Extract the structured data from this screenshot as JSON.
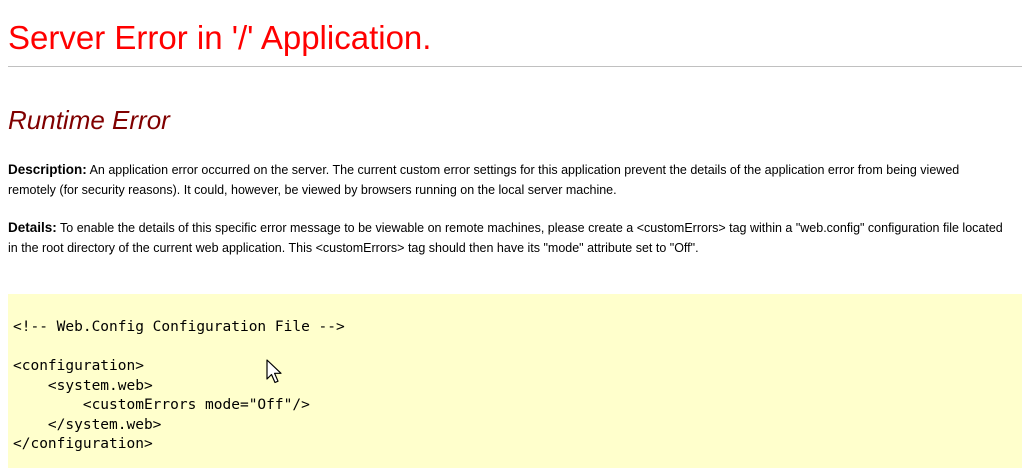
{
  "header": {
    "title": "Server Error in '/' Application."
  },
  "error": {
    "heading": "Runtime Error",
    "description_label": "Description:",
    "description_text": "An application error occurred on the server. The current custom error settings for this application prevent the details of the application error from being viewed remotely (for security reasons). It could, however, be viewed by browsers running on the local server machine.",
    "details_label": "Details:",
    "details_text": "To enable the details of this specific error message to be viewable on remote machines, please create a <customErrors> tag within a \"web.config\" configuration file located in the root directory of the current web application. This <customErrors> tag should then have its \"mode\" attribute set to \"Off\"."
  },
  "code_sample": {
    "lines": [
      "<!-- Web.Config Configuration File -->",
      "",
      "<configuration>",
      "    <system.web>",
      "        <customErrors mode=\"Off\"/>",
      "    </system.web>",
      "</configuration>"
    ]
  },
  "colors": {
    "title": "#ff0000",
    "heading": "#800000",
    "code_background": "#ffffcc"
  },
  "icons": {
    "mouse_pointer": "arrow-cursor-icon"
  }
}
